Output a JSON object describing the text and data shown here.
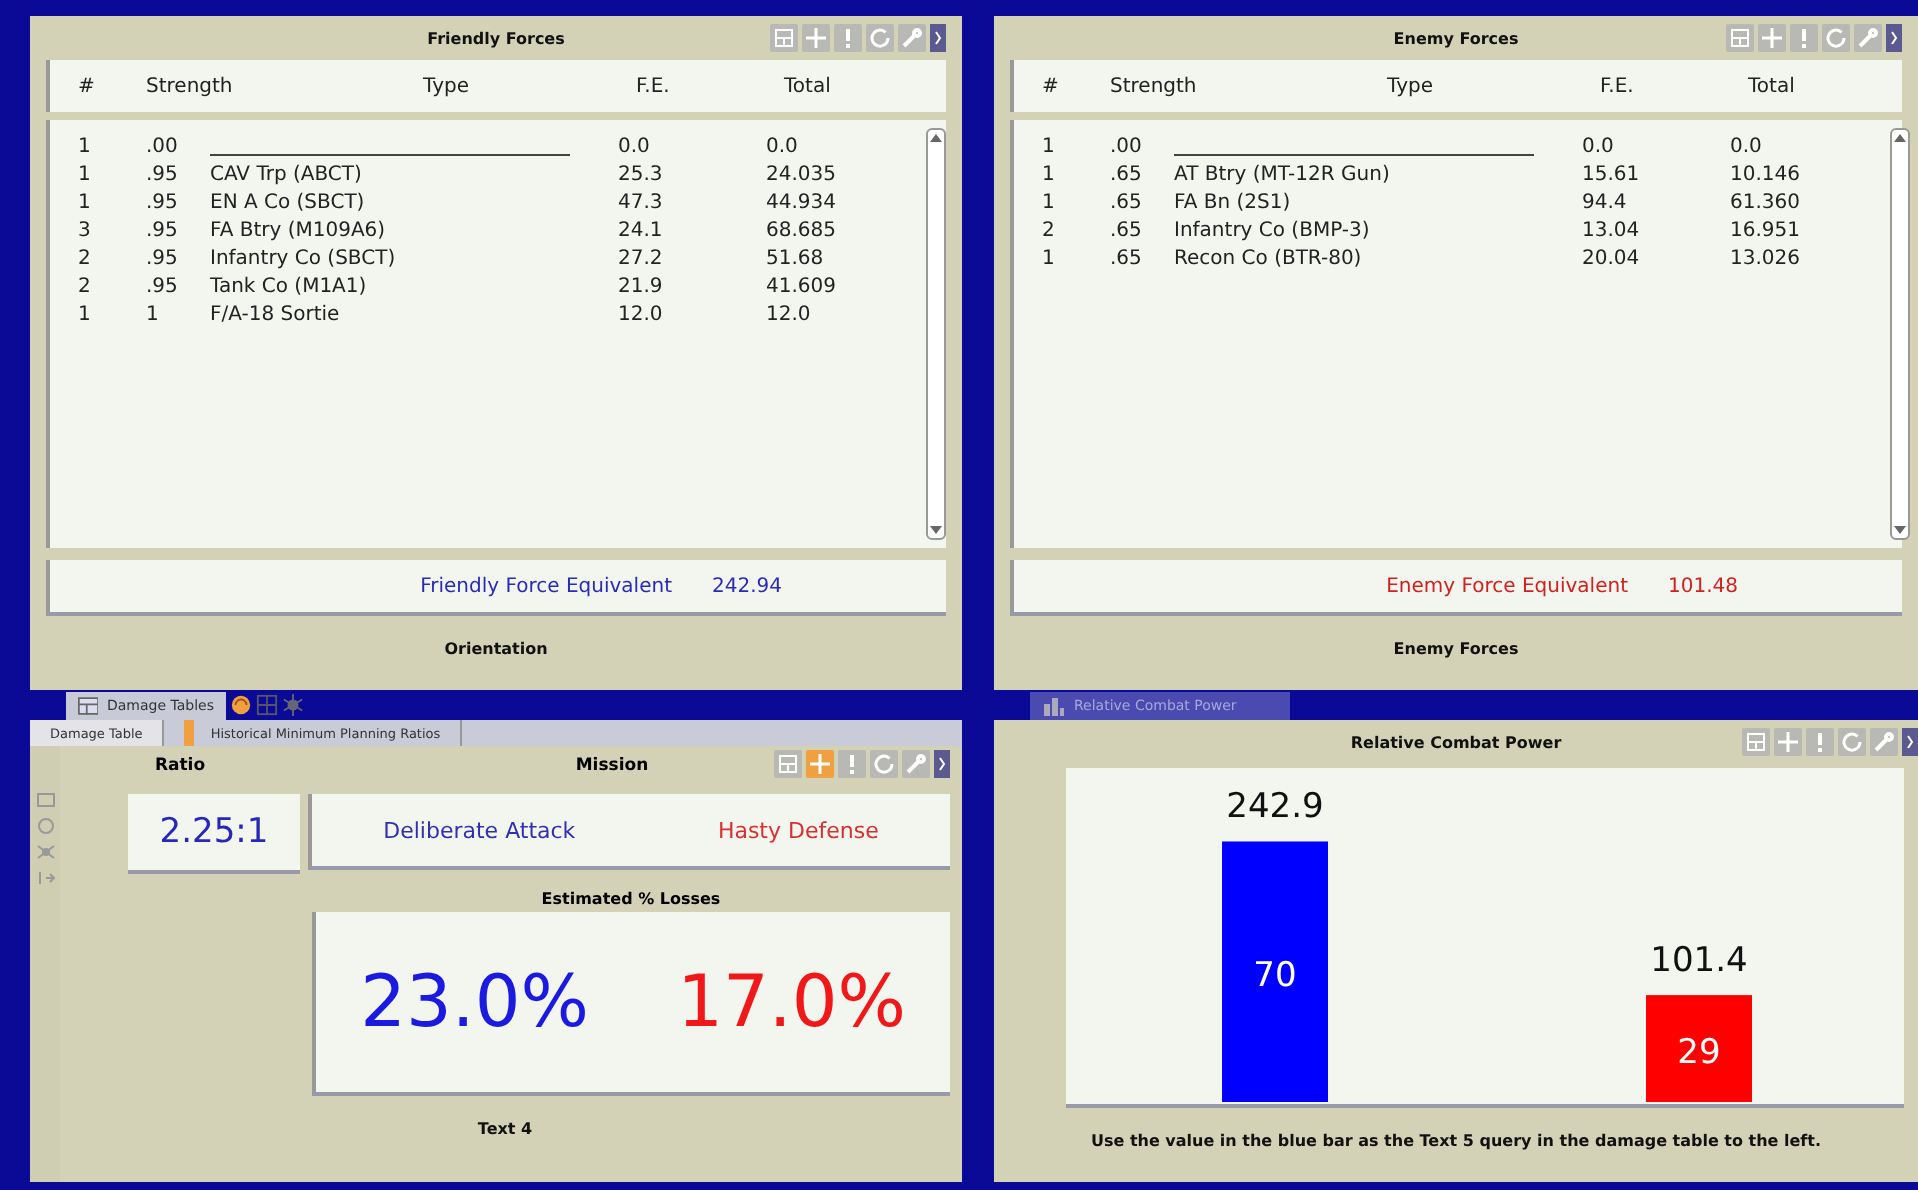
{
  "force_panels": [
    {
      "title": "Friendly Forces",
      "color": "#2a2ab8",
      "columns": [
        "#",
        "Strength",
        "Type",
        "F.E.",
        "Total"
      ],
      "toolbar": [
        {
          "kind": "layout",
          "highlighted": false
        },
        {
          "kind": "move",
          "highlighted": false
        },
        {
          "kind": "alert",
          "highlighted": false
        },
        {
          "kind": "refresh",
          "highlighted": false
        },
        {
          "kind": "wrench",
          "highlighted": false
        }
      ],
      "rows": [
        {
          "kind": "blank",
          "count": "1",
          "strength": ".00",
          "fe": "0.0",
          "total": "0.0"
        },
        {
          "kind": "entry",
          "count": "1",
          "strength": ".95",
          "type": "CAV Trp (ABCT)",
          "fe": "25.3",
          "total": "24.035"
        },
        {
          "kind": "entry",
          "count": "1",
          "strength": ".95",
          "type": "EN A Co (SBCT)",
          "fe": "47.3",
          "total": "44.934"
        },
        {
          "kind": "entry",
          "count": "3",
          "strength": ".95",
          "type": "FA Btry (M109A6)",
          "fe": "24.1",
          "total": "68.685"
        },
        {
          "kind": "entry",
          "count": "2",
          "strength": ".95",
          "type": "Infantry Co (SBCT)",
          "fe": "27.2",
          "total": "51.68"
        },
        {
          "kind": "entry",
          "count": "2",
          "strength": ".95",
          "type": "Tank Co (M1A1)",
          "fe": "21.9",
          "total": "41.609"
        },
        {
          "kind": "entry",
          "count": "1",
          "strength": "1",
          "type": "F/A-18 Sortie",
          "fe": "12.0",
          "total": "12.0"
        }
      ],
      "total_label": "Friendly Force Equivalent",
      "total_value": "242.94",
      "caption": "Orientation"
    },
    {
      "title": "Enemy Forces",
      "color": "#d02020",
      "columns": [
        "#",
        "Strength",
        "Type",
        "F.E.",
        "Total"
      ],
      "toolbar": [
        {
          "kind": "layout",
          "highlighted": false
        },
        {
          "kind": "move",
          "highlighted": false
        },
        {
          "kind": "alert",
          "highlighted": false
        },
        {
          "kind": "refresh",
          "highlighted": false
        },
        {
          "kind": "wrench",
          "highlighted": false
        }
      ],
      "rows": [
        {
          "kind": "blank",
          "count": "1",
          "strength": ".00",
          "fe": "0.0",
          "total": "0.0"
        },
        {
          "kind": "entry",
          "count": "1",
          "strength": ".65",
          "type": "AT Btry (MT-12R Gun)",
          "fe": "15.61",
          "total": "10.146"
        },
        {
          "kind": "entry",
          "count": "1",
          "strength": ".65",
          "type": "FA Bn (2S1)",
          "fe": "94.4",
          "total": "61.360"
        },
        {
          "kind": "entry",
          "count": "2",
          "strength": ".65",
          "type": "Infantry Co (BMP-3)",
          "fe": "13.04",
          "total": "16.951"
        },
        {
          "kind": "entry",
          "count": "1",
          "strength": ".65",
          "type": "Recon Co (BTR-80)",
          "fe": "20.04",
          "total": "13.026"
        }
      ],
      "total_label": "Enemy Force Equivalent",
      "total_value": "101.48",
      "caption": "Enemy Forces"
    }
  ],
  "damage_panel": {
    "window_tab": "Damage Tables",
    "tabs": [
      {
        "label": "Damage Table",
        "selected": true,
        "flagged": false
      },
      {
        "label": "Historical Minimum Planning Ratios",
        "selected": false,
        "flagged": true
      }
    ],
    "toolbar": [
      {
        "kind": "layout",
        "highlighted": false
      },
      {
        "kind": "move",
        "highlighted": true
      },
      {
        "kind": "alert",
        "highlighted": false
      },
      {
        "kind": "refresh",
        "highlighted": false
      },
      {
        "kind": "wrench",
        "highlighted": false
      }
    ],
    "ratio_header": "Ratio",
    "mission_header": "Mission",
    "ratio": "2.25:1",
    "missions": [
      {
        "label": "Deliberate Attack",
        "color": "#3030b0"
      },
      {
        "label": "Hasty Defense",
        "color": "#d83030"
      }
    ],
    "losses_header": "Estimated % Losses",
    "losses": [
      {
        "value": "23.0%",
        "color": "#1a1ae0"
      },
      {
        "value": "17.0%",
        "color": "#f01818"
      }
    ],
    "caption": "Text 4"
  },
  "combat_panel": {
    "window_tab": "Relative Combat Power",
    "title": "Relative Combat Power",
    "toolbar": [
      {
        "kind": "layout",
        "highlighted": false
      },
      {
        "kind": "move",
        "highlighted": false
      },
      {
        "kind": "alert",
        "highlighted": false
      },
      {
        "kind": "refresh",
        "highlighted": false
      },
      {
        "kind": "wrench",
        "highlighted": false
      }
    ],
    "bars": [
      {
        "value": "242.9",
        "inner": "70",
        "color": "#0000ff",
        "level": 0.78
      },
      {
        "value": "101.4",
        "inner": "29",
        "color": "#ff0000",
        "level": 0.32
      }
    ],
    "caption": "Use the value in the blue bar as the Text 5 query in the damage table to the left."
  }
}
